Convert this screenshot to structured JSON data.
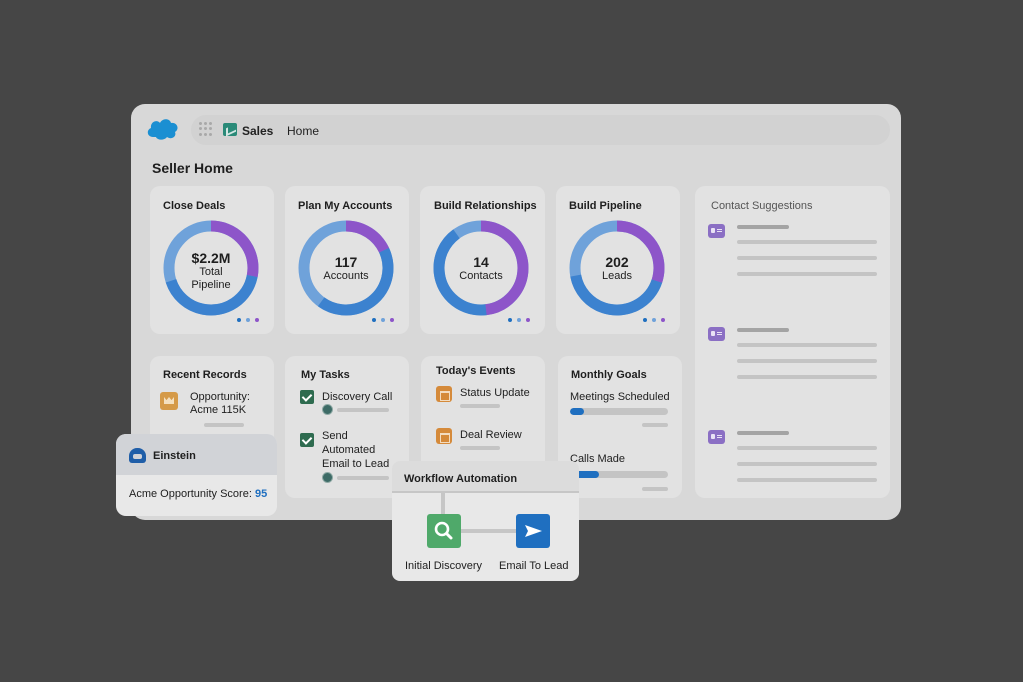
{
  "header": {
    "app_name": "Sales",
    "nav_home": "Home"
  },
  "page_title": "Seller Home",
  "kpis": [
    {
      "title": "Close Deals",
      "value": "$2.2M",
      "label_line1": "Total",
      "label_line2": "Pipeline",
      "ring_segments": [
        0.28,
        0.72
      ]
    },
    {
      "title": "Plan My Accounts",
      "value": "117",
      "label_line1": "Accounts",
      "label_line2": "",
      "ring_segments": [
        0.18,
        0.82
      ]
    },
    {
      "title": "Build Relationships",
      "value": "14",
      "label_line1": "Contacts",
      "label_line2": "",
      "ring_segments": [
        0.48,
        0.52
      ]
    },
    {
      "title": "Build Pipeline",
      "value": "202",
      "label_line1": "Leads",
      "label_line2": "",
      "ring_segments": [
        0.3,
        0.7
      ]
    }
  ],
  "ring_colors": {
    "accent": "#8d55c9",
    "primary": "#3c82cf",
    "secondary": "#6fa2da"
  },
  "contact_suggestions": {
    "title": "Contact Suggestions"
  },
  "recent_records": {
    "title": "Recent Records",
    "item_line1": "Opportunity:",
    "item_line2": "Acme 115K"
  },
  "my_tasks": {
    "title": "My Tasks",
    "task1": "Discovery Call",
    "task2_line1": "Send",
    "task2_line2": "Automated",
    "task2_line3": "Email to Lead"
  },
  "events": {
    "title": "Today's Events",
    "event1": "Status Update",
    "event2": "Deal Review"
  },
  "goals": {
    "title": "Monthly Goals",
    "goal1_label": "Meetings Scheduled",
    "goal1_progress": 0.14,
    "goal2_label": "Calls Made",
    "goal2_progress": 0.3
  },
  "einstein": {
    "title": "Einstein",
    "score_label": "Acme Opportunity Score:",
    "score_value": "95"
  },
  "workflow": {
    "title": "Workflow Automation",
    "step1": "Initial Discovery",
    "step2": "Email To Lead"
  },
  "icons": {
    "logo": "salesforce-cloud-icon",
    "launcher": "app-launcher-icon",
    "contact": "contact-card-icon",
    "record": "opportunity-crown-icon",
    "task": "checkbox-icon",
    "event": "calendar-icon",
    "search": "search-icon",
    "send": "send-icon"
  }
}
